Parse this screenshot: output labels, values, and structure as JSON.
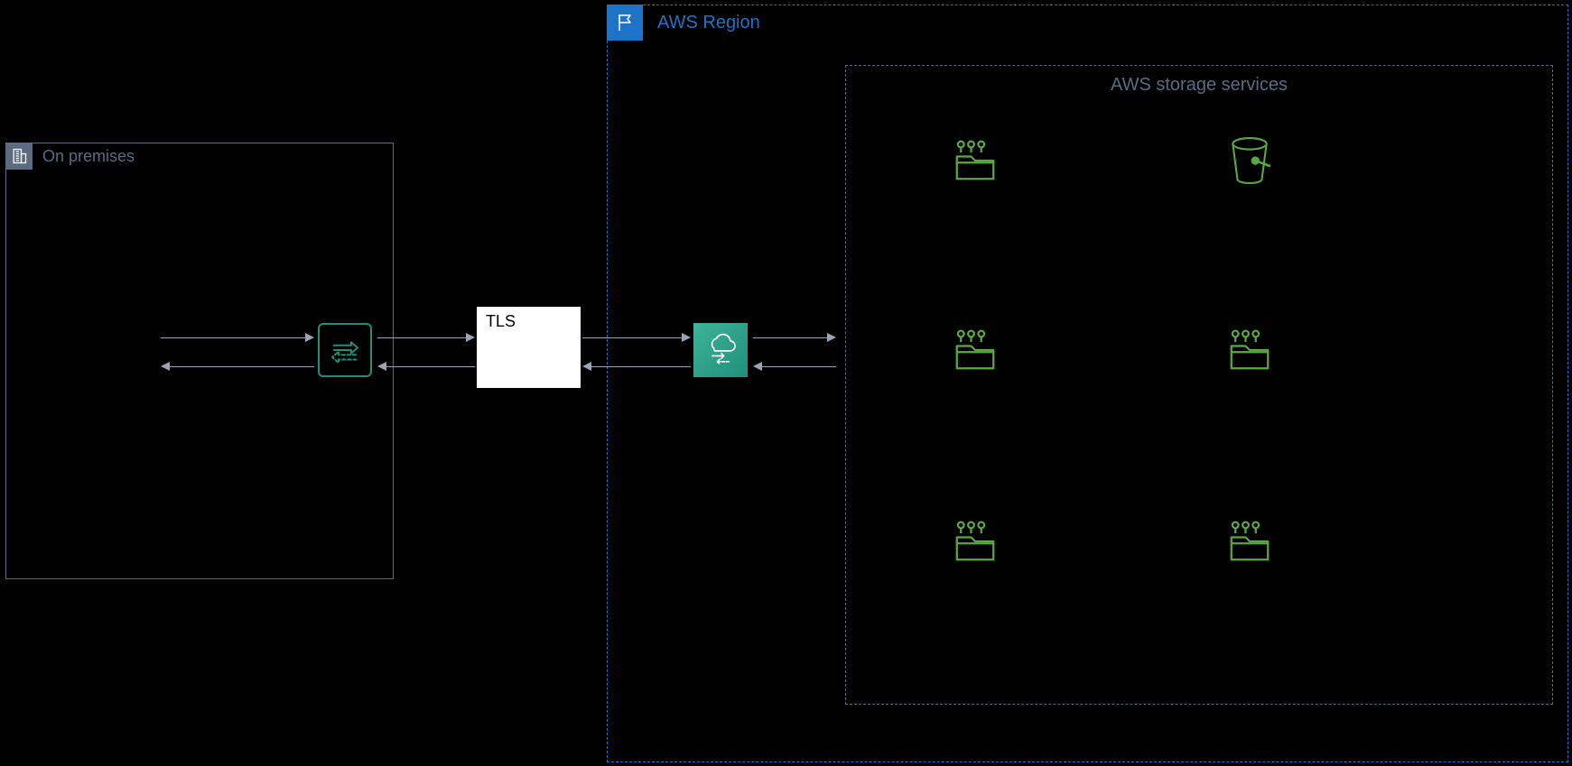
{
  "onprem": {
    "label": "On premises"
  },
  "region": {
    "label": "AWS Region"
  },
  "storage": {
    "label": "AWS storage services"
  },
  "tls": {
    "label": "TLS"
  },
  "nodes": {
    "agent": "datasync-agent",
    "service": "aws-datasync",
    "fsx_a": "amazon-fsx",
    "s3": "amazon-s3",
    "fsx_b": "amazon-fsx",
    "fsx_c": "amazon-fsx",
    "fsx_d": "amazon-fsx",
    "fsx_e": "amazon-fsx"
  },
  "connections": [
    {
      "from": "onprem-storage",
      "to": "datasync-agent",
      "bidirectional": true
    },
    {
      "from": "datasync-agent",
      "to": "aws-datasync",
      "via": "TLS",
      "bidirectional": true
    },
    {
      "from": "aws-datasync",
      "to": "aws-storage-services",
      "bidirectional": true
    }
  ]
}
